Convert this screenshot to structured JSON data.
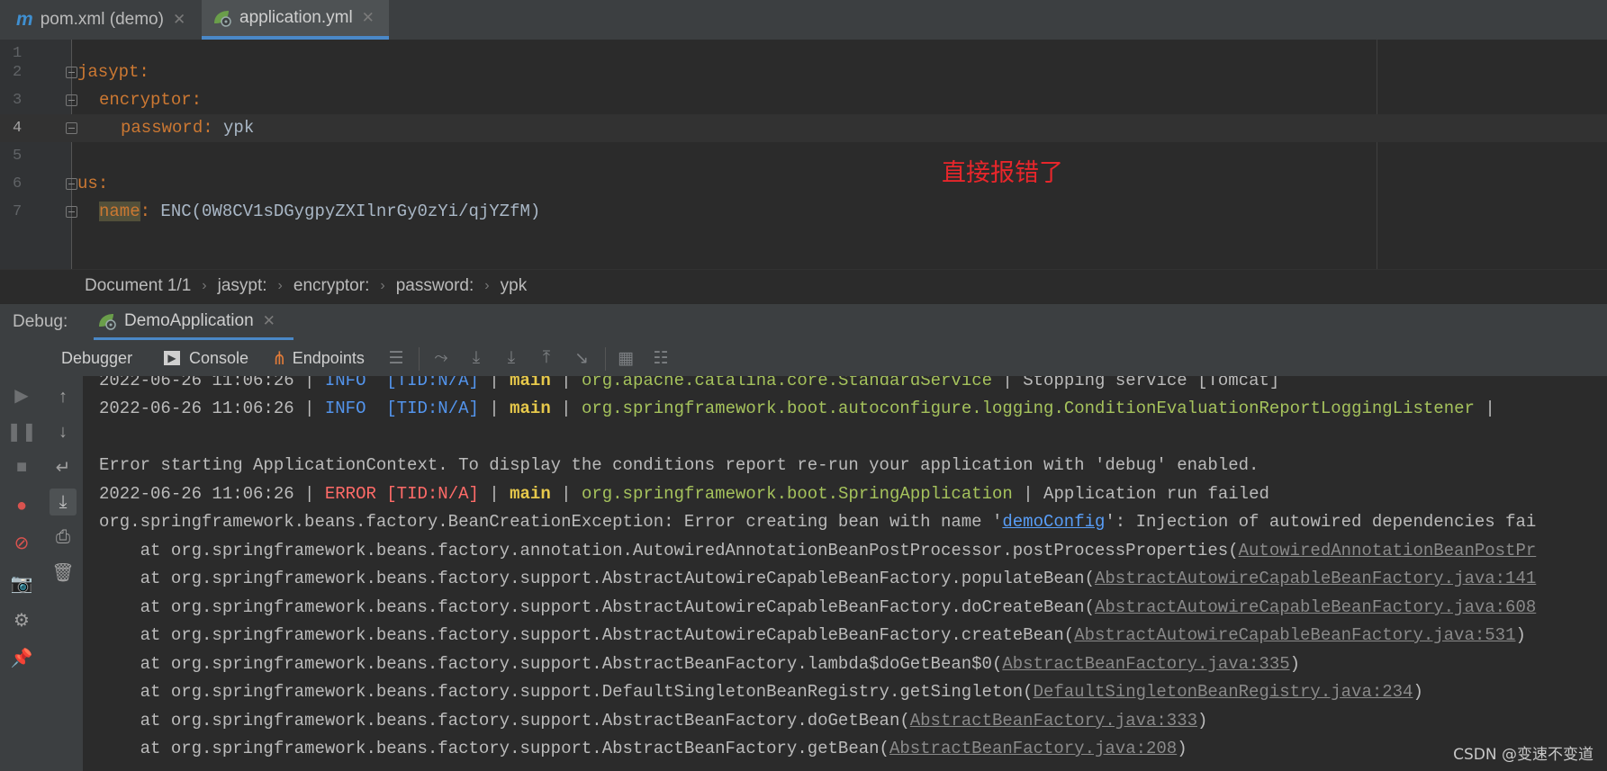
{
  "tabs": [
    {
      "label": "pom.xml (demo)",
      "icon": "maven-icon",
      "active": false
    },
    {
      "label": "application.yml",
      "icon": "spring-leaf-icon",
      "active": true
    }
  ],
  "editor": {
    "line_numbers": [
      "1",
      "2",
      "3",
      "4",
      "5",
      "6",
      "7"
    ],
    "current_line": 4,
    "lines": {
      "l2_key": "jasypt",
      "l3_key": "encryptor",
      "l4_key": "password",
      "l4_val": "ypk",
      "l6_key": "us",
      "l7_key": "name",
      "l7_val": "ENC(0W8CV1sDGygpyZXIlnrGy0zYi/qjYZfM)"
    },
    "annotation": "直接报错了"
  },
  "breadcrumb": [
    "Document 1/1",
    "jasypt:",
    "encryptor:",
    "password:",
    "ypk"
  ],
  "debug": {
    "label": "Debug:",
    "run_tab": "DemoApplication",
    "toolbar": {
      "debugger": "Debugger",
      "console": "Console",
      "endpoints": "Endpoints"
    }
  },
  "console": {
    "l1": {
      "ts": "2022-06-26 11:06:26",
      "level": "INFO ",
      "tid": "[TID:N/A]",
      "thread": "main",
      "cls": "org.apache.catalina.core.StandardService",
      "msg": " | Stopping service [Tomcat]"
    },
    "l2": {
      "ts": "2022-06-26 11:06:26",
      "level": "INFO ",
      "tid": "[TID:N/A]",
      "thread": "main",
      "cls": "org.springframework.boot.autoconfigure.logging.ConditionEvaluationReportLoggingListener",
      "msg": " |"
    },
    "l4": "Error starting ApplicationContext. To display the conditions report re-run your application with 'debug' enabled.",
    "l5": {
      "ts": "2022-06-26 11:06:26",
      "level": "ERROR",
      "tid": "[TID:N/A]",
      "thread": "main",
      "cls": "org.springframework.boot.SpringApplication",
      "msg": " | Application run failed"
    },
    "l6": {
      "pre": "org.springframework.beans.factory.BeanCreationException: Error creating bean with name '",
      "link": "demoConfig",
      "post": "': Injection of autowired dependencies fai"
    },
    "stack": [
      {
        "at": "    at org.springframework.beans.factory.annotation.AutowiredAnnotationBeanPostProcessor.postProcessProperties(",
        "src": "AutowiredAnnotationBeanPostPr",
        "end": ""
      },
      {
        "at": "    at org.springframework.beans.factory.support.AbstractAutowireCapableBeanFactory.populateBean(",
        "src": "AbstractAutowireCapableBeanFactory.java:141",
        "end": ""
      },
      {
        "at": "    at org.springframework.beans.factory.support.AbstractAutowireCapableBeanFactory.doCreateBean(",
        "src": "AbstractAutowireCapableBeanFactory.java:608",
        "end": ""
      },
      {
        "at": "    at org.springframework.beans.factory.support.AbstractAutowireCapableBeanFactory.createBean(",
        "src": "AbstractAutowireCapableBeanFactory.java:531",
        "end": ")"
      },
      {
        "at": "    at org.springframework.beans.factory.support.AbstractBeanFactory.lambda$doGetBean$0(",
        "src": "AbstractBeanFactory.java:335",
        "end": ")"
      },
      {
        "at": "    at org.springframework.beans.factory.support.DefaultSingletonBeanRegistry.getSingleton(",
        "src": "DefaultSingletonBeanRegistry.java:234",
        "end": ")"
      },
      {
        "at": "    at org.springframework.beans.factory.support.AbstractBeanFactory.doGetBean(",
        "src": "AbstractBeanFactory.java:333",
        "end": ")"
      },
      {
        "at": "    at org.springframework.beans.factory.support.AbstractBeanFactory.getBean(",
        "src": "AbstractBeanFactory.java:208",
        "end": ")"
      }
    ]
  },
  "watermark": "CSDN @变速不变道",
  "colors": {
    "accent": "#4a88c7",
    "yaml_key": "#cc7832",
    "info": "#5394ec",
    "error": "#ff6b68",
    "class": "#a5c25c",
    "annotation": "#e8262b"
  }
}
